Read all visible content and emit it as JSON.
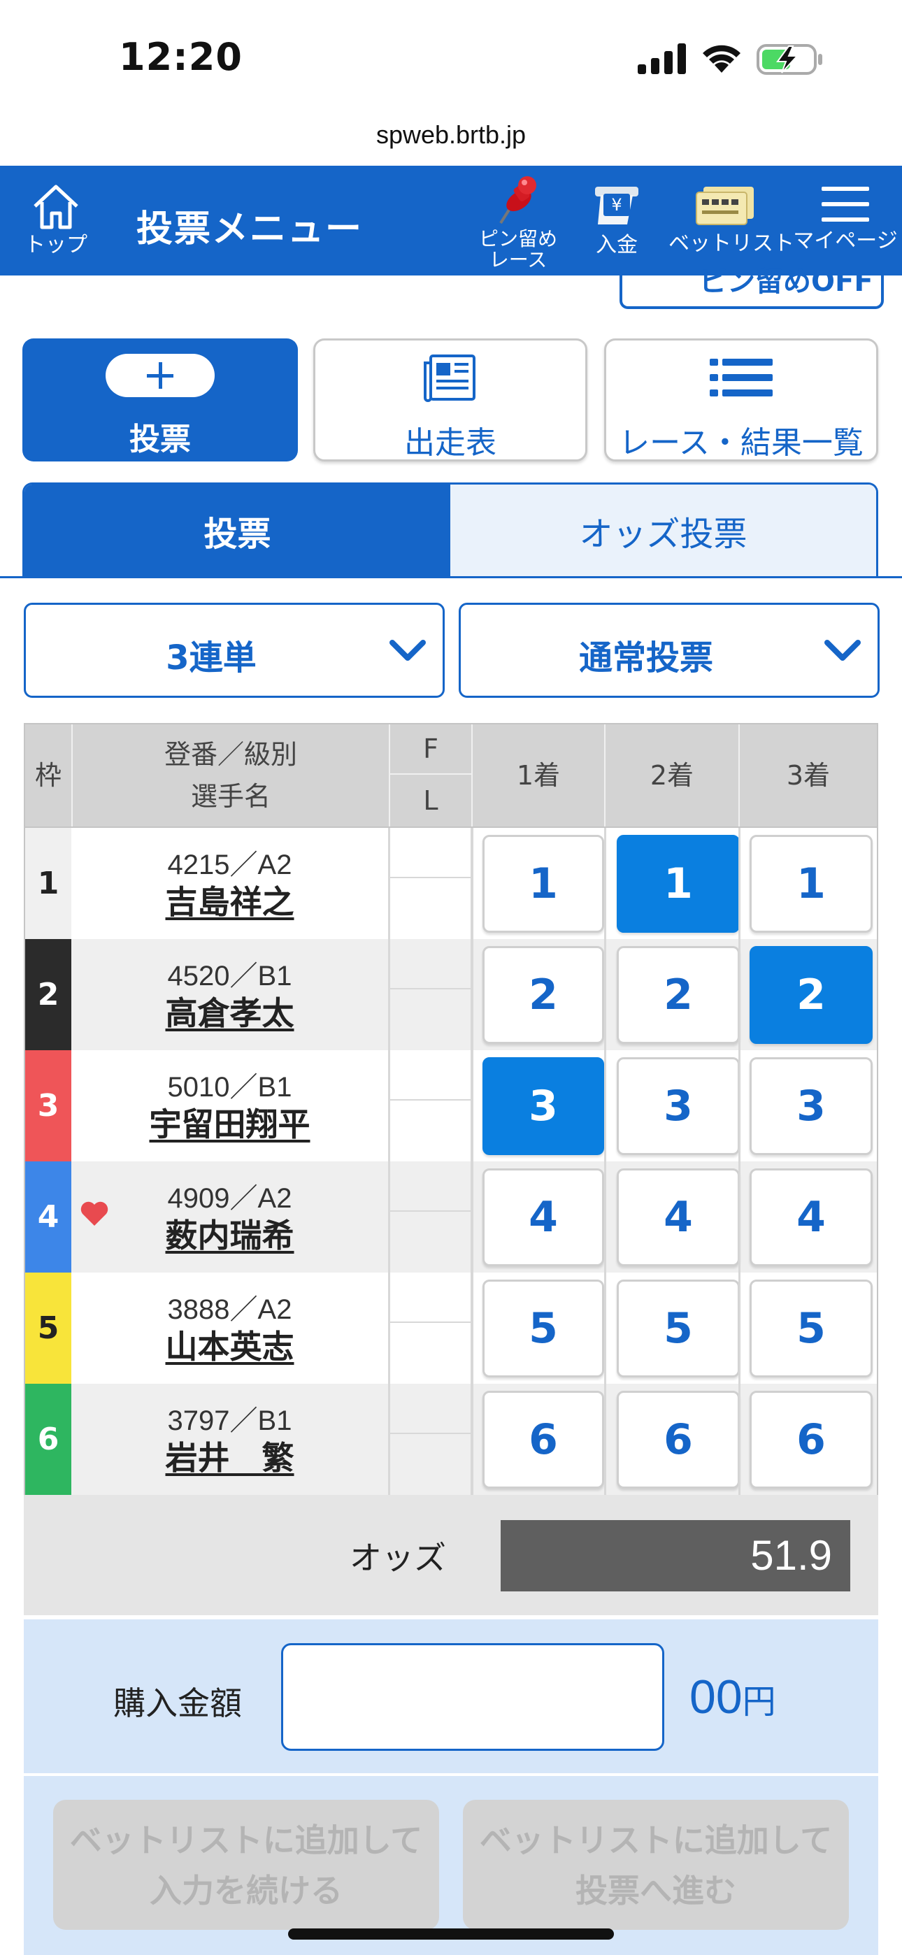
{
  "status_bar": {
    "time": "12:20"
  },
  "browser": {
    "url": "spweb.brtb.jp"
  },
  "header": {
    "home_label": "トップ",
    "title": "投票メニュー",
    "pin_label_line1": "ピン留め",
    "pin_label_line2": "レース",
    "deposit_label": "入金",
    "betlist_label": "ベットリスト",
    "mypage_label": "マイページ"
  },
  "pin_off_label": "ピン留めOFF",
  "menu_cards": {
    "vote": "投票",
    "entry": "出走表",
    "results": "レース・結果一覧"
  },
  "tabs": {
    "vote": "投票",
    "odds_vote": "オッズ投票"
  },
  "selects": {
    "bet_type": "3連単",
    "vote_method": "通常投票"
  },
  "table": {
    "headers": {
      "waku": "枠",
      "racer_line1": "登番／級別",
      "racer_line2": "選手名",
      "f": "F",
      "l": "L",
      "first": "1着",
      "second": "2着",
      "third": "3着"
    },
    "rows": [
      {
        "waku": "1",
        "id": "4215／A2",
        "name": "吉島祥之",
        "waku_bg": "#f0f0f0",
        "waku_fg": "#222222",
        "favorite": false,
        "picks": [
          "1",
          "1",
          "1"
        ],
        "selected": [
          false,
          true,
          false
        ]
      },
      {
        "waku": "2",
        "id": "4520／B1",
        "name": "高倉孝太",
        "waku_bg": "#2b2b2b",
        "waku_fg": "#ffffff",
        "favorite": false,
        "picks": [
          "2",
          "2",
          "2"
        ],
        "selected": [
          false,
          false,
          true
        ]
      },
      {
        "waku": "3",
        "id": "5010／B1",
        "name": "宇留田翔平",
        "waku_bg": "#ef5558",
        "waku_fg": "#ffffff",
        "favorite": false,
        "picks": [
          "3",
          "3",
          "3"
        ],
        "selected": [
          true,
          false,
          false
        ]
      },
      {
        "waku": "4",
        "id": "4909／A2",
        "name": "薮内瑞希",
        "waku_bg": "#3d86e8",
        "waku_fg": "#ffffff",
        "favorite": true,
        "picks": [
          "4",
          "4",
          "4"
        ],
        "selected": [
          false,
          false,
          false
        ]
      },
      {
        "waku": "5",
        "id": "3888／A2",
        "name": "山本英志",
        "waku_bg": "#f8e43a",
        "waku_fg": "#222222",
        "favorite": false,
        "picks": [
          "5",
          "5",
          "5"
        ],
        "selected": [
          false,
          false,
          false
        ]
      },
      {
        "waku": "6",
        "id": "3797／B1",
        "name": "岩井　繁",
        "waku_bg": "#2eb660",
        "waku_fg": "#ffffff",
        "favorite": false,
        "picks": [
          "6",
          "6",
          "6"
        ],
        "selected": [
          false,
          false,
          false
        ]
      }
    ]
  },
  "odds": {
    "label": "オッズ",
    "value": "51.9"
  },
  "purchase": {
    "amount_label": "購入金額",
    "amount_value": "",
    "suffix_digits": "00",
    "suffix_unit": "円",
    "add_continue_line1": "ベットリストに追加して",
    "add_continue_line2": "入力を続ける",
    "add_proceed_line1": "ベットリストに追加して",
    "add_proceed_line2": "投票へ進む"
  },
  "colors": {
    "brand_blue": "#1565c8",
    "selected_blue": "#0a7fe0",
    "heart_red": "#e84a4f"
  }
}
